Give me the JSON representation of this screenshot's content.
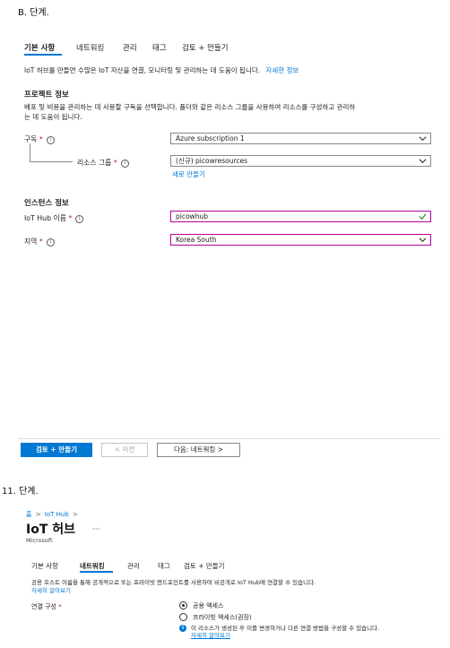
{
  "step_b": "B.  단계.",
  "step_11": "11.  단계.",
  "create": {
    "tabs": [
      "기본 사항",
      "네트워킹",
      "관리",
      "태그",
      "검토 + 만들기"
    ],
    "intro": "IoT 허브를 만들면 수많은 IoT 자산을 연결, 모니터링 및 관리하는 데 도움이 됩니다.",
    "learn_more": "자세한 정보",
    "project_heading": "프로젝트 정보",
    "project_desc_1": "배포 및 비용을 관리하는 데 사용할 구독을 선택합니다. 폴더와 같은 리소스 그룹을 사용하여 리소스를 구성하고 관리하",
    "project_desc_2": "는 데 도움이 됩니다.",
    "subscription_label": "구독",
    "subscription_value": "Azure subscription 1",
    "rg_label": "리소스 그룹",
    "rg_value": "(신규) picowresources",
    "create_new": "새로 만들기",
    "instance_heading": "인스턴스 정보",
    "hub_name_label": "IoT Hub 이름",
    "hub_name_value": "picowhub",
    "region_label": "지역",
    "region_value": "Korea South",
    "required_mark": "*",
    "info_glyph": "i",
    "review_button": "검토 + 만들기",
    "prev_button": "< 이전",
    "next_button": "다음: 네트워킹 >"
  },
  "hub": {
    "breadcrumb_home": "홈",
    "breadcrumb_sep": ">",
    "breadcrumb_iothub": "IoT Hub",
    "title": "IoT 허브",
    "more": "···",
    "subtitle": "Microsoft",
    "tabs": [
      "기본 사항",
      "네트워킹",
      "관리",
      "태그",
      "검토 + 만들기"
    ],
    "desc": "공용 호스트 이름을 통해 공개적으로 또는 프라이빗 엔드포인트를 사용하여 비공개로 IoT Hub에 연결할 수 있습니다.",
    "learn_more": "자세히 알아보기",
    "conn_label": "연결 구성",
    "option_public": "공용 액세스",
    "option_private": "프라이빗 액세스(권장)",
    "note": "이 리소스가 생성된 후 이를 변경하거나 다른 연결 방법을 구성할 수 있습니다.",
    "note_link": "자세히 알아보기"
  },
  "colors": {
    "accent": "#0078d4",
    "focus": "#b4009e",
    "valid": "#107c10",
    "required": "#a4262c"
  }
}
